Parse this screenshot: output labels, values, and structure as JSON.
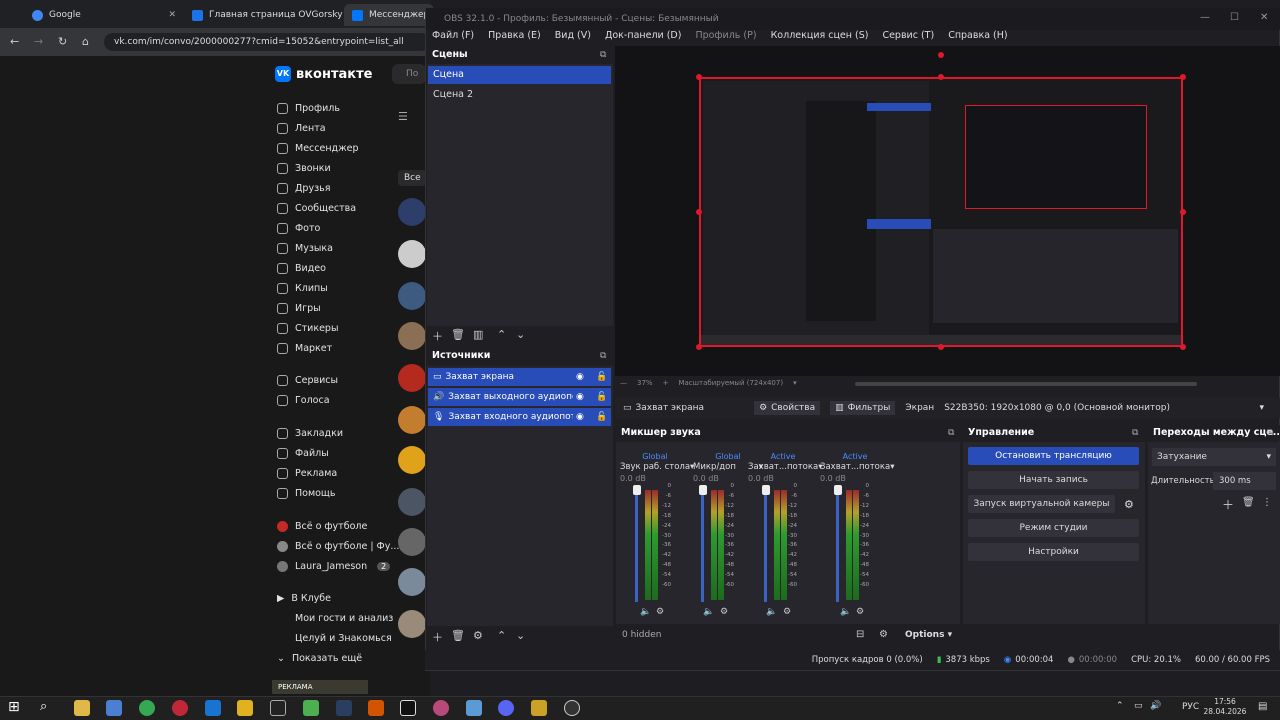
{
  "browser": {
    "tabs": [
      {
        "title": "Google"
      },
      {
        "title": "Главная страница OVGorsky"
      },
      {
        "title": "Мессенджер"
      }
    ],
    "url": "vk.com/im/convo/2000000277?cmid=15052&entrypoint=list_all",
    "vk": {
      "logo": "вконтакте",
      "logo_mark": "VK",
      "search_prefix": "По",
      "filter_all": "Все",
      "nav": [
        "Профиль",
        "Лента",
        "Мессенджер",
        "Звонки",
        "Друзья",
        "Сообщества",
        "Фото",
        "Музыка",
        "Видео",
        "Клипы",
        "Игры",
        "Стикеры",
        "Маркет"
      ],
      "nav2": [
        "Сервисы",
        "Голоса"
      ],
      "nav3": [
        "Закладки",
        "Файлы",
        "Реклама",
        "Помощь"
      ],
      "groups": [
        {
          "label": "Всё о футболе"
        },
        {
          "label": "Всё о футболе | Фу..."
        },
        {
          "label": "Laura_Jameson",
          "badge": "2"
        }
      ],
      "club": [
        "В Клубе",
        "Мои гости и анализ",
        "Целуй и Знакомься",
        "Показать ещё"
      ],
      "ad_label": "РЕКЛАМА"
    }
  },
  "obs": {
    "title": "OBS 32.1.0 - Профиль: Безымянный - Сцены: Безымянный",
    "menu": [
      "Файл (F)",
      "Правка (E)",
      "Вид (V)",
      "Док-панели (D)",
      "Профиль (P)",
      "Коллекция сцен (S)",
      "Сервис (T)",
      "Справка (H)"
    ],
    "scenes_title": "Сцены",
    "scenes": [
      "Сцена",
      "Сцена 2"
    ],
    "sources_title": "Источники",
    "sources": [
      "Захват экрана",
      "Захват выходного аудиопотока",
      "Захват входного аудиопотока"
    ],
    "preview_zoom": "37%",
    "preview_scale": "Масштабируемый (724x407)",
    "context": {
      "source": "Захват экрана",
      "properties": "Свойства",
      "filters": "Фильтры",
      "screen_label": "Экран",
      "screen_value": "S22B350: 1920x1080 @ 0,0 (Основной монитор)"
    },
    "mixer_title": "Микшер звука",
    "mixer": [
      {
        "tag": "Global",
        "name": "Звук раб. стола",
        "db": "0.0 dB"
      },
      {
        "tag": "Global",
        "name": "Микр/доп",
        "db": "0.0 dB"
      },
      {
        "tag": "Active",
        "name": "Захват...потока",
        "db": "0.0 dB"
      },
      {
        "tag": "Active",
        "name": "Захват...потока",
        "db": "0.0 dB"
      }
    ],
    "meter_ticks": [
      "0",
      "-6",
      "-12",
      "-18",
      "-24",
      "-30",
      "-36",
      "-42",
      "-48",
      "-54",
      "-60"
    ],
    "mixer_hidden": "0 hidden",
    "mixer_options": "Options",
    "controls_title": "Управление",
    "controls": [
      "Остановить трансляцию",
      "Начать запись",
      "Запуск виртуальной камеры",
      "Режим студии",
      "Настройки"
    ],
    "transitions_title": "Переходы между сце...",
    "transition": "Затухание",
    "duration_label": "Длительность",
    "duration_value": "300 ms",
    "status": {
      "dropped": "Пропуск кадров 0 (0.0%)",
      "bitrate": "3873 kbps",
      "stream_time": "00:00:04",
      "rec_time": "00:00:00",
      "cpu": "CPU: 20.1%",
      "fps": "60.00 / 60.00 FPS"
    }
  },
  "taskbar": {
    "lang": "РУС",
    "time": "17:56",
    "date": "28.04.2026"
  },
  "colors": {
    "accent": "#284cb8",
    "selection_red": "#e0182c",
    "vk_blue": "#0077ff"
  }
}
